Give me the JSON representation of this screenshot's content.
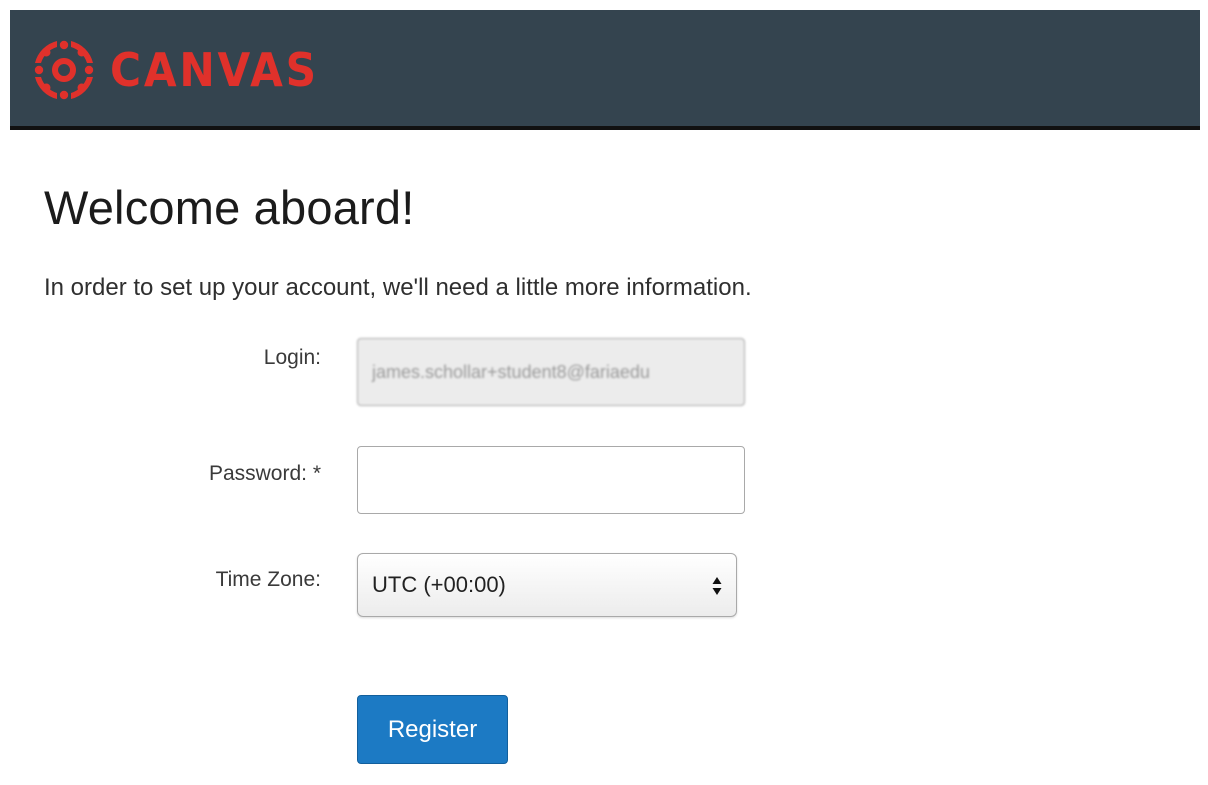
{
  "header": {
    "brand_text": "CANVAS",
    "logo_icon": "canvas-logo-icon",
    "background_color": "#34444f",
    "brand_color": "#e0312b"
  },
  "main": {
    "title": "Welcome aboard!",
    "subtitle": "In order to set up your account, we'll need a little more information."
  },
  "form": {
    "login_label": "Login:",
    "login_value": "james.schollar+student8@fariaedu",
    "password_label": "Password: *",
    "password_value": "",
    "timezone_label": "Time Zone:",
    "timezone_selected": "UTC (+00:00)",
    "timezone_icon": "select-arrows-icon",
    "register_label": "Register",
    "register_color": "#1c7ac4"
  }
}
